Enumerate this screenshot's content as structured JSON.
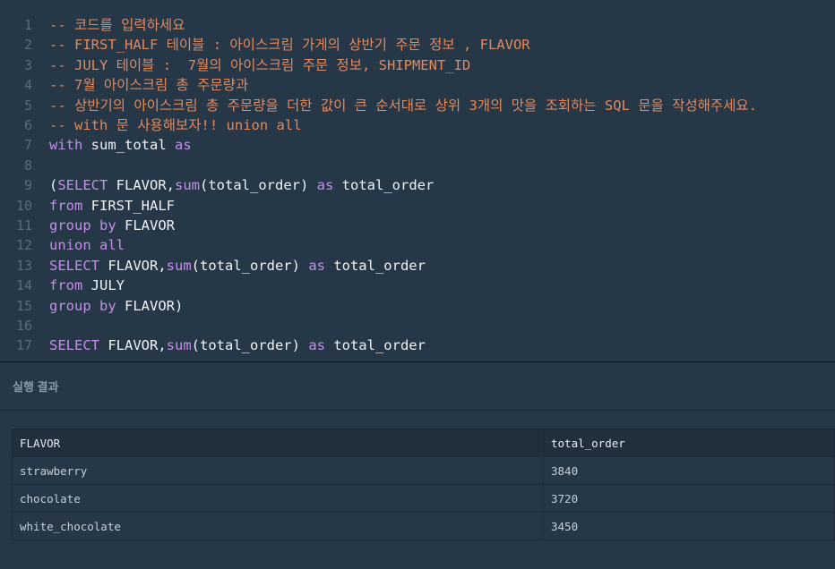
{
  "editor": {
    "lines": [
      {
        "n": "1",
        "segs": [
          {
            "t": "-- 코드를 입력하세요",
            "c": "comment"
          }
        ]
      },
      {
        "n": "2",
        "segs": [
          {
            "t": "-- FIRST_HALF 테이블 : 아이스크림 가게의 상반기 주문 정보 , FLAVOR",
            "c": "comment"
          }
        ]
      },
      {
        "n": "3",
        "segs": [
          {
            "t": "-- JULY 테이블 :  7월의 아이스크림 주문 정보, SHIPMENT_ID",
            "c": "comment"
          }
        ]
      },
      {
        "n": "4",
        "segs": [
          {
            "t": "-- 7월 아이스크림 총 주문량과",
            "c": "comment"
          }
        ]
      },
      {
        "n": "5",
        "segs": [
          {
            "t": "-- 상반기의 아이스크림 총 주문량을 더한 값이 큰 순서대로 상위 3개의 맛을 조회하는 SQL 문을 작성해주세요.",
            "c": "comment"
          }
        ]
      },
      {
        "n": "6",
        "segs": [
          {
            "t": "-- with 문 사용해보자!! union all",
            "c": "comment"
          }
        ]
      },
      {
        "n": "7",
        "segs": [
          {
            "t": "with",
            "c": "kw"
          },
          {
            "t": " sum_total ",
            "c": ""
          },
          {
            "t": "as",
            "c": "kw"
          }
        ]
      },
      {
        "n": "8",
        "segs": []
      },
      {
        "n": "9",
        "segs": [
          {
            "t": "(",
            "c": ""
          },
          {
            "t": "SELECT",
            "c": "kw"
          },
          {
            "t": " FLAVOR,",
            "c": ""
          },
          {
            "t": "sum",
            "c": "kw"
          },
          {
            "t": "(total_order) ",
            "c": ""
          },
          {
            "t": "as",
            "c": "kw"
          },
          {
            "t": " total_order",
            "c": ""
          }
        ]
      },
      {
        "n": "10",
        "segs": [
          {
            "t": "from",
            "c": "kw"
          },
          {
            "t": " FIRST_HALF",
            "c": ""
          }
        ]
      },
      {
        "n": "11",
        "segs": [
          {
            "t": "group by",
            "c": "kw"
          },
          {
            "t": " FLAVOR",
            "c": ""
          }
        ]
      },
      {
        "n": "12",
        "segs": [
          {
            "t": "union all",
            "c": "kw"
          }
        ]
      },
      {
        "n": "13",
        "segs": [
          {
            "t": "SELECT",
            "c": "kw"
          },
          {
            "t": " FLAVOR,",
            "c": ""
          },
          {
            "t": "sum",
            "c": "kw"
          },
          {
            "t": "(total_order) ",
            "c": ""
          },
          {
            "t": "as",
            "c": "kw"
          },
          {
            "t": " total_order",
            "c": ""
          }
        ]
      },
      {
        "n": "14",
        "segs": [
          {
            "t": "from",
            "c": "kw"
          },
          {
            "t": " JULY",
            "c": ""
          }
        ]
      },
      {
        "n": "15",
        "segs": [
          {
            "t": "group by",
            "c": "kw"
          },
          {
            "t": " FLAVOR)",
            "c": ""
          }
        ]
      },
      {
        "n": "16",
        "segs": []
      },
      {
        "n": "17",
        "segs": [
          {
            "t": "SELECT",
            "c": "kw"
          },
          {
            "t": " FLAVOR,",
            "c": ""
          },
          {
            "t": "sum",
            "c": "kw"
          },
          {
            "t": "(total_order) ",
            "c": ""
          },
          {
            "t": "as",
            "c": "kw"
          },
          {
            "t": " total_order",
            "c": ""
          }
        ]
      }
    ]
  },
  "result": {
    "title": "실행 결과",
    "columns": [
      "FLAVOR",
      "total_order"
    ],
    "rows": [
      [
        "strawberry",
        "3840"
      ],
      [
        "chocolate",
        "3720"
      ],
      [
        "white_chocolate",
        "3450"
      ]
    ]
  },
  "colors": {
    "background": "#263747",
    "comment": "#e2895d",
    "keyword": "#c38fe8",
    "text": "#f0f3f5",
    "line_number": "#5b6b7a"
  }
}
